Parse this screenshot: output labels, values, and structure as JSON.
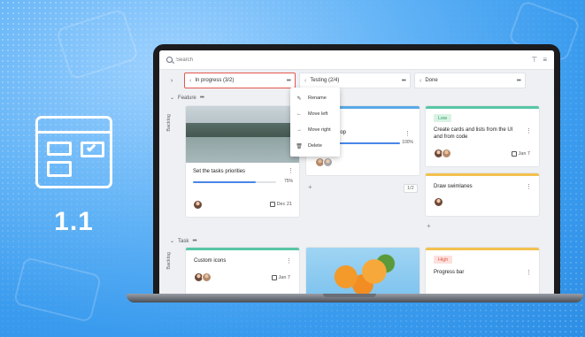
{
  "version": "1.1",
  "search": {
    "placeholder": "Search"
  },
  "columns": [
    {
      "label": "In progress (3/2)"
    },
    {
      "label": "Testing (2/4)"
    },
    {
      "label": "Done"
    }
  ],
  "lanes": {
    "feature": "Feature",
    "task": "Task",
    "backlog": "Backlog"
  },
  "menu": {
    "items": [
      "Rename",
      "Move left",
      "Move right",
      "Delete"
    ]
  },
  "cards": {
    "set_priorities": {
      "title": "Set the tasks priorities",
      "progress_label": "75%",
      "progress": 0.75,
      "due": "Dec 21"
    },
    "testing_card": {
      "title_fragment": "drop",
      "progress_label": "100%",
      "progress": 1.0
    },
    "create_cards": {
      "tag": "Low",
      "title": "Create cards and lists from the UI and from code",
      "due": "Jan 7"
    },
    "draw_swimlanes": {
      "title": "Draw swimlanes"
    },
    "custom_icons": {
      "title": "Custom icons",
      "due": "Jan 7"
    },
    "progress_bar": {
      "tag": "High",
      "title": "Progress bar"
    }
  },
  "testing_pager": "1/2",
  "colors": {
    "accent_blue": "#4a86e8",
    "active_border": "#e4574e",
    "stripe_teal": "#59c6a6",
    "stripe_yellow": "#f2c14e",
    "stripe_blue": "#5aa9e6",
    "tag_low_bg": "#d8f3e4",
    "tag_low_fg": "#2e9e63",
    "tag_high_bg": "#fde0dc",
    "tag_high_fg": "#e4574e"
  }
}
